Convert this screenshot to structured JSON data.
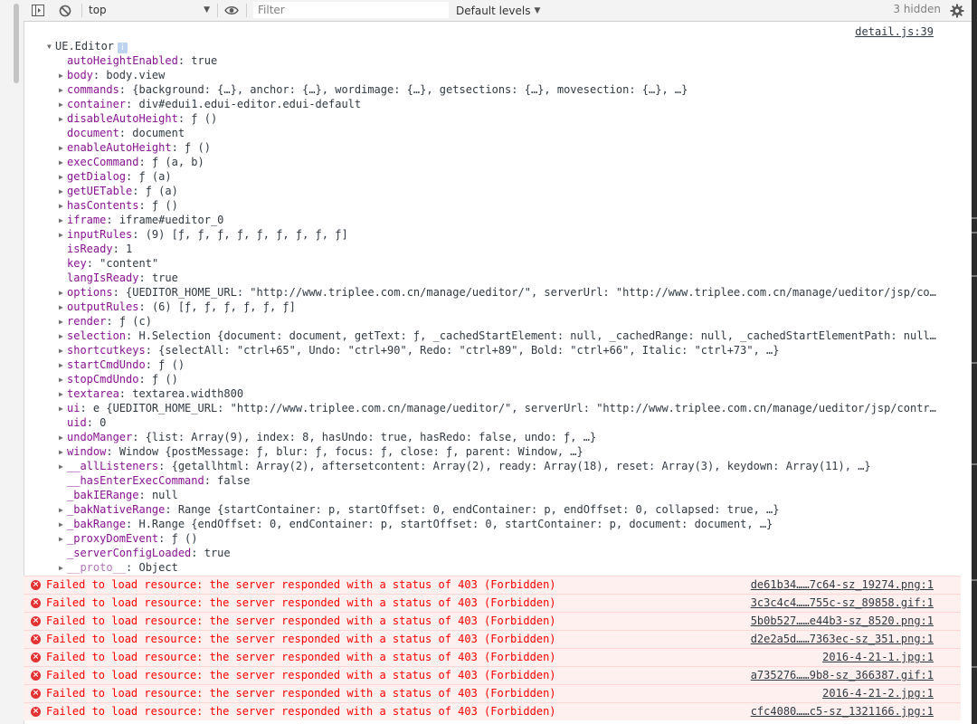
{
  "toolbar": {
    "context": "top",
    "filter_placeholder": "Filter",
    "levels": "Default levels",
    "hidden": "3 hidden"
  },
  "log": {
    "source": "detail.js:39",
    "object_name": "UE.Editor",
    "info_badge": "i",
    "props": [
      {
        "expandable": false,
        "key": "autoHeightEnabled",
        "value": "true"
      },
      {
        "expandable": true,
        "key": "body",
        "value": "body.view"
      },
      {
        "expandable": true,
        "key": "commands",
        "value": "{background: {…}, anchor: {…}, wordimage: {…}, getsections: {…}, movesection: {…}, …}"
      },
      {
        "expandable": true,
        "key": "container",
        "value": "div#edui1.edui-editor.edui-default"
      },
      {
        "expandable": true,
        "key": "disableAutoHeight",
        "value": "ƒ ()"
      },
      {
        "expandable": false,
        "key": "document",
        "value": "document"
      },
      {
        "expandable": true,
        "key": "enableAutoHeight",
        "value": "ƒ ()"
      },
      {
        "expandable": true,
        "key": "execCommand",
        "value": "ƒ (a, b)"
      },
      {
        "expandable": true,
        "key": "getDialog",
        "value": "ƒ (a)"
      },
      {
        "expandable": true,
        "key": "getUETable",
        "value": "ƒ (a)"
      },
      {
        "expandable": true,
        "key": "hasContents",
        "value": "ƒ ()"
      },
      {
        "expandable": true,
        "key": "iframe",
        "value": "iframe#ueditor_0"
      },
      {
        "expandable": true,
        "key": "inputRules",
        "value": "(9) [ƒ, ƒ, ƒ, ƒ, ƒ, ƒ, ƒ, ƒ, ƒ]"
      },
      {
        "expandable": false,
        "key": "isReady",
        "value": "1"
      },
      {
        "expandable": false,
        "key": "key",
        "value": "\"content\""
      },
      {
        "expandable": false,
        "key": "langIsReady",
        "value": "true"
      },
      {
        "expandable": true,
        "key": "options",
        "value": "{UEDITOR_HOME_URL: \"http://www.triplee.com.cn/manage/ueditor/\", serverUrl: \"http://www.triplee.com.cn/manage/ueditor/jsp/co…"
      },
      {
        "expandable": true,
        "key": "outputRules",
        "value": "(6) [ƒ, ƒ, ƒ, ƒ, ƒ, ƒ]"
      },
      {
        "expandable": true,
        "key": "render",
        "value": "ƒ (c)"
      },
      {
        "expandable": true,
        "key": "selection",
        "value": "H.Selection {document: document, getText: ƒ, _cachedStartElement: null, _cachedRange: null, _cachedStartElementPath: null…"
      },
      {
        "expandable": true,
        "key": "shortcutkeys",
        "value": "{selectAll: \"ctrl+65\", Undo: \"ctrl+90\", Redo: \"ctrl+89\", Bold: \"ctrl+66\", Italic: \"ctrl+73\", …}"
      },
      {
        "expandable": true,
        "key": "startCmdUndo",
        "value": "ƒ ()"
      },
      {
        "expandable": true,
        "key": "stopCmdUndo",
        "value": "ƒ ()"
      },
      {
        "expandable": true,
        "key": "textarea",
        "value": "textarea.width800"
      },
      {
        "expandable": true,
        "key": "ui",
        "value": "e {UEDITOR_HOME_URL: \"http://www.triplee.com.cn/manage/ueditor/\", serverUrl: \"http://www.triplee.com.cn/manage/ueditor/jsp/contr…"
      },
      {
        "expandable": false,
        "key": "uid",
        "value": "0"
      },
      {
        "expandable": true,
        "key": "undoManger",
        "value": "{list: Array(9), index: 8, hasUndo: true, hasRedo: false, undo: ƒ, …}"
      },
      {
        "expandable": true,
        "key": "window",
        "value": "Window {postMessage: ƒ, blur: ƒ, focus: ƒ, close: ƒ, parent: Window, …}"
      },
      {
        "expandable": true,
        "key": "__allListeners",
        "value": "{getallhtml: Array(2), aftersetcontent: Array(2), ready: Array(18), reset: Array(3), keydown: Array(11), …}"
      },
      {
        "expandable": false,
        "key": "__hasEnterExecCommand",
        "value": "false"
      },
      {
        "expandable": false,
        "key": "_bakIERange",
        "value": "null"
      },
      {
        "expandable": true,
        "key": "_bakNativeRange",
        "value": "Range {startContainer: p, startOffset: 0, endContainer: p, endOffset: 0, collapsed: true, …}"
      },
      {
        "expandable": true,
        "key": "_bakRange",
        "value": "H.Range {endOffset: 0, endContainer: p, startOffset: 0, startContainer: p, document: document, …}"
      },
      {
        "expandable": true,
        "key": "_proxyDomEvent",
        "value": "ƒ ()"
      },
      {
        "expandable": false,
        "key": "_serverConfigLoaded",
        "value": "true"
      },
      {
        "expandable": true,
        "key": "__proto__",
        "value": "Object",
        "dim": true
      }
    ]
  },
  "errors": [
    {
      "message": "Failed to load resource: the server responded with a status of 403 (Forbidden)",
      "source": "de61b34……7c64-sz_19274.png:1"
    },
    {
      "message": "Failed to load resource: the server responded with a status of 403 (Forbidden)",
      "source": "3c3c4c4……755c-sz_89858.gif:1"
    },
    {
      "message": "Failed to load resource: the server responded with a status of 403 (Forbidden)",
      "source": "5b0b527……e44b3-sz_8520.png:1"
    },
    {
      "message": "Failed to load resource: the server responded with a status of 403 (Forbidden)",
      "source": "d2e2a5d……7363ec-sz_351.png:1"
    },
    {
      "message": "Failed to load resource: the server responded with a status of 403 (Forbidden)",
      "source": "2016-4-21-1.jpg:1"
    },
    {
      "message": "Failed to load resource: the server responded with a status of 403 (Forbidden)",
      "source": "a735276……9b8-sz_366387.gif:1"
    },
    {
      "message": "Failed to load resource: the server responded with a status of 403 (Forbidden)",
      "source": "2016-4-21-2.jpg:1"
    },
    {
      "message": "Failed to load resource: the server responded with a status of 403 (Forbidden)",
      "source": "cfc4080……c5-sz_1321166.jpg:1"
    }
  ]
}
